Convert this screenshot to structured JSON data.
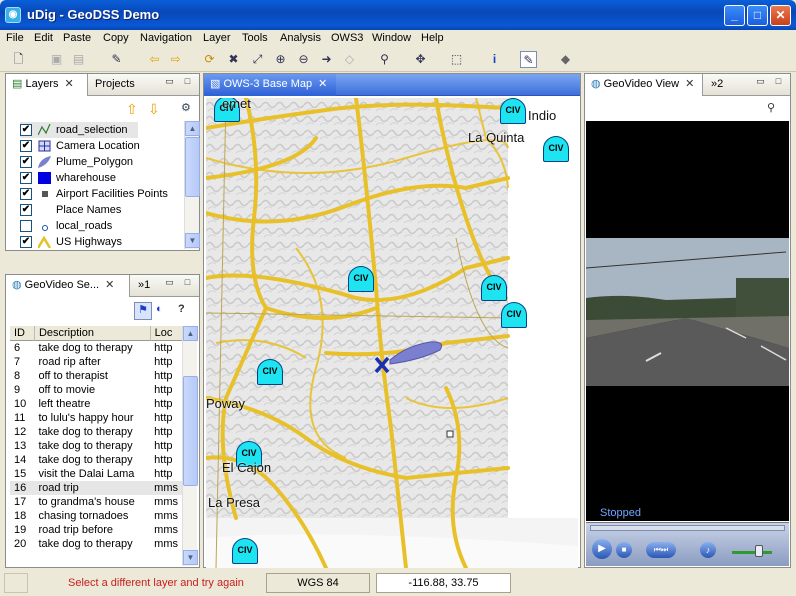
{
  "window": {
    "title": "uDig - GeoDSS Demo",
    "minimize": "_",
    "maximize": "□",
    "close": "✕",
    "app_icon": "globe-icon"
  },
  "menu": [
    "File",
    "Edit",
    "Paste",
    "Copy",
    "Navigation",
    "Layer",
    "Tools",
    "Analysis",
    "OWS3",
    "Window",
    "Help"
  ],
  "layers_panel": {
    "tabs": [
      "Layers",
      "Projects"
    ],
    "items": [
      {
        "label": "road_selection",
        "checked": true,
        "icon": "line-icon"
      },
      {
        "label": "Camera Location",
        "checked": true,
        "icon": "camera-grid-icon"
      },
      {
        "label": "Plume_Polygon",
        "checked": true,
        "icon": "polygon-icon"
      },
      {
        "label": "wharehouse",
        "checked": true,
        "icon": "blue-square-icon"
      },
      {
        "label": "Airport Facilities Points",
        "checked": true,
        "icon": "point-icon"
      },
      {
        "label": "Place Names",
        "checked": true,
        "icon": ""
      },
      {
        "label": "local_roads",
        "checked": false,
        "icon": "point-circle-icon"
      },
      {
        "label": "US Highways",
        "checked": true,
        "icon": "highway-icon"
      }
    ]
  },
  "search_panel": {
    "tab": "GeoVideo Se...",
    "overflow": "»1",
    "columns": [
      "ID",
      "Description",
      "Loc"
    ],
    "rows": [
      {
        "id": "6",
        "desc": "take dog to therapy",
        "loc": "http"
      },
      {
        "id": "7",
        "desc": "road rip after",
        "loc": "http"
      },
      {
        "id": "8",
        "desc": "off to therapist",
        "loc": "http"
      },
      {
        "id": "9",
        "desc": "off to movie",
        "loc": "http"
      },
      {
        "id": "10",
        "desc": "left theatre",
        "loc": "http"
      },
      {
        "id": "11",
        "desc": "to lulu's happy hour",
        "loc": "http"
      },
      {
        "id": "12",
        "desc": "take dog to therapy",
        "loc": "http"
      },
      {
        "id": "13",
        "desc": "take dog to therapy",
        "loc": "http"
      },
      {
        "id": "14",
        "desc": "take dog to therapy",
        "loc": "http"
      },
      {
        "id": "15",
        "desc": "visit the Dalai Lama",
        "loc": "http"
      },
      {
        "id": "16",
        "desc": "road trip",
        "loc": "mms"
      },
      {
        "id": "17",
        "desc": "to grandma's house",
        "loc": "mms"
      },
      {
        "id": "18",
        "desc": "chasing tornadoes",
        "loc": "mms"
      },
      {
        "id": "19",
        "desc": "road trip before",
        "loc": "mms"
      },
      {
        "id": "20",
        "desc": "take dog to therapy",
        "loc": "mms"
      }
    ]
  },
  "map": {
    "tab": "OWS-3 Base Map",
    "marker_label": "CIV",
    "places": [
      "emet",
      "La Quinta",
      "Indio",
      "Poway",
      "El Cajon",
      "La Presa"
    ]
  },
  "video": {
    "tab": "GeoVideo View",
    "overflow": "»2",
    "status": "Stopped"
  },
  "status": {
    "message": "Select a different layer and try again",
    "crs": "WGS 84",
    "coords": "-116.88, 33.75"
  },
  "colors": {
    "highway": "#e8c12a",
    "civ_marker": "#1ee3f0",
    "selection": "#1a2fb0",
    "plume": "#7b7fd0"
  }
}
